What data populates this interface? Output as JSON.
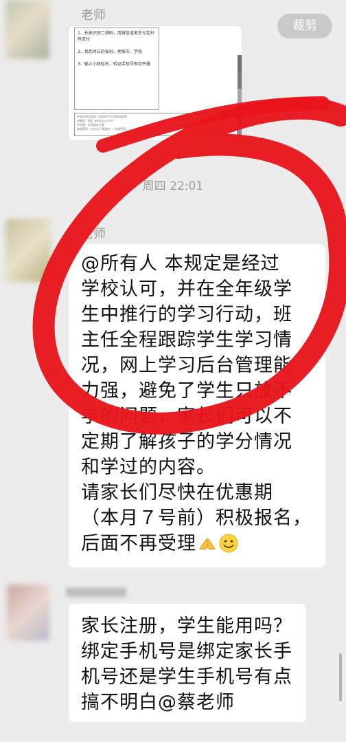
{
  "toolbar": {
    "crop_label": "裁剪"
  },
  "messages": [
    {
      "sender": "老师",
      "image": {
        "steps": [
          "1、长按识别二维码，用微信或者支付宝扫码支付",
          "2、找到对应的省份、地级市、学校",
          "3、输入小孩姓名，验证手机号即可开通"
        ],
        "footer": [
          "开通后使用流程（导流码手机号密码登录）",
          "电脑版：网址 www.xxx.com",
          "手机版：应用商店下载",
          "修改密码：点击右下角我的——修改密码"
        ]
      }
    }
  ],
  "timestamp": "周四 22:01",
  "announcement": {
    "sender": "老师",
    "lines": [
      "@所有人  本规定是经过",
      "学校认可，并在全年级学",
      "生中推行的学习行动，班",
      "主任全程跟踪学生学习情",
      "况，网上学习后台管理能",
      "力强，避免了学生只放不",
      "学的问题，家长们可以不",
      "定期了解孩子的学分情况",
      "和学过的内容。",
      "请家长们尽快在优惠期",
      "（本月７号前）积极报名，",
      "后面不再受理"
    ],
    "emojis": [
      "pray-icon",
      "smile-icon"
    ]
  },
  "reply": {
    "lines": [
      "家长注册，学生能用吗？",
      "绑定手机号是绑定家长手",
      "机号还是学生手机号有点",
      "搞不明白@蔡老师"
    ]
  },
  "colors": {
    "background": "#ececec",
    "bubble": "#ffffff",
    "annotation_red": "#e8141b",
    "meta_text": "#9e9e9e"
  }
}
